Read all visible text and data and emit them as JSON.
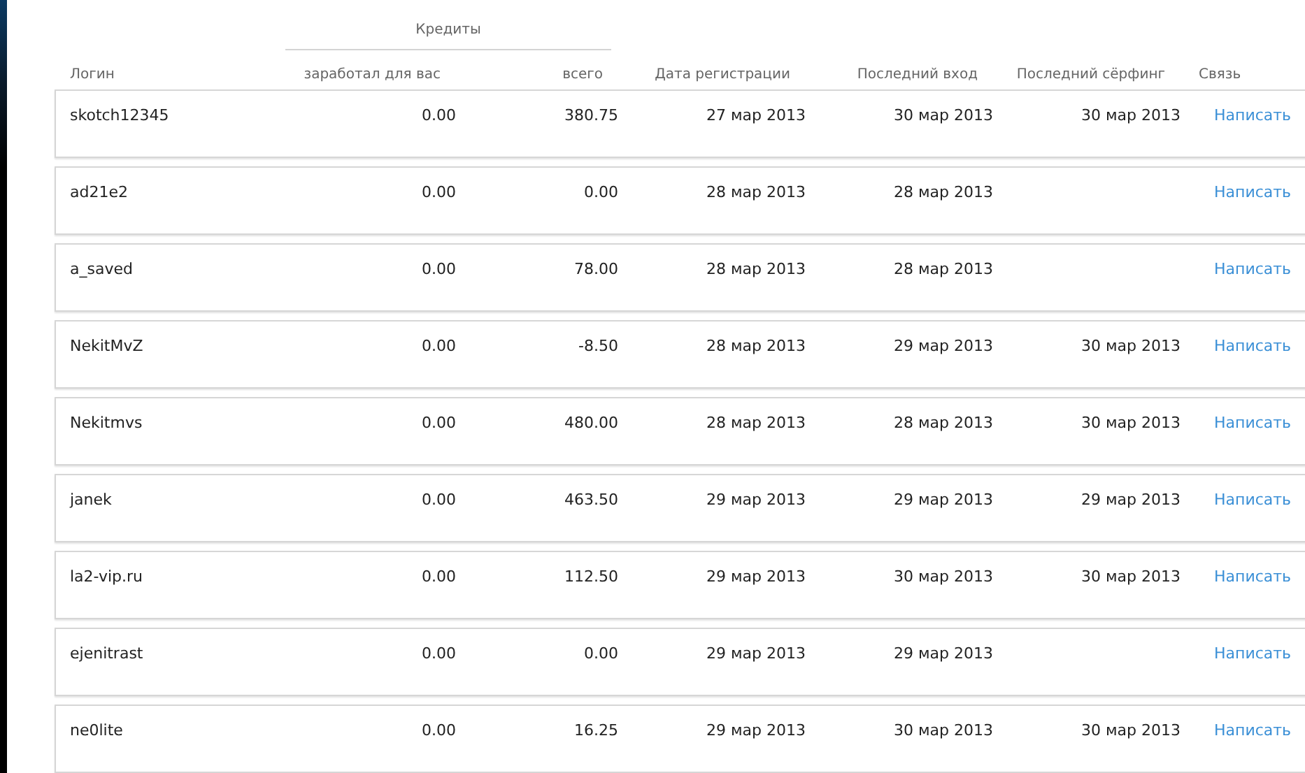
{
  "table": {
    "group_header": "Кредиты",
    "columns": [
      "Логин",
      "заработал для вас",
      "всего",
      "Дата регистрации",
      "Последний вход",
      "Последний сёрфинг",
      "Связь"
    ],
    "rows": [
      {
        "login": "skotch12345",
        "earned": "0.00",
        "total": "380.75",
        "registered": "27 мар 2013",
        "last_login": "30 мар 2013",
        "last_surf": "30 мар 2013",
        "contact": "Написать"
      },
      {
        "login": "ad21e2",
        "earned": "0.00",
        "total": "0.00",
        "registered": "28 мар 2013",
        "last_login": "28 мар 2013",
        "contact": "Написать"
      },
      {
        "login": "a_saved",
        "earned": "0.00",
        "total": "78.00",
        "registered": "28 мар 2013",
        "last_login": "28 мар 2013",
        "contact": "Написать"
      },
      {
        "login": "NekitMvZ",
        "earned": "0.00",
        "total": "-8.50",
        "registered": "28 мар 2013",
        "last_login": "29 мар 2013",
        "last_surf": "30 мар 2013",
        "contact": "Написать"
      },
      {
        "login": "Nekitmvs",
        "earned": "0.00",
        "total": "480.00",
        "registered": "28 мар 2013",
        "last_login": "28 мар 2013",
        "last_surf": "30 мар 2013",
        "contact": "Написать"
      },
      {
        "login": "janek",
        "earned": "0.00",
        "total": "463.50",
        "registered": "29 мар 2013",
        "last_login": "29 мар 2013",
        "last_surf": "29 мар 2013",
        "contact": "Написать"
      },
      {
        "login": "la2-vip.ru",
        "earned": "0.00",
        "total": "112.50",
        "registered": "29 мар 2013",
        "last_login": "30 мар 2013",
        "last_surf": "30 мар 2013",
        "contact": "Написать"
      },
      {
        "login": "ejenitrast",
        "earned": "0.00",
        "total": "0.00",
        "registered": "29 мар 2013",
        "last_login": "29 мар 2013",
        "contact": "Написать"
      },
      {
        "login": "ne0lite",
        "earned": "0.00",
        "total": "16.25",
        "registered": "29 мар 2013",
        "last_login": "30 мар 2013",
        "last_surf": "30 мар 2013",
        "contact": "Написать"
      }
    ]
  }
}
